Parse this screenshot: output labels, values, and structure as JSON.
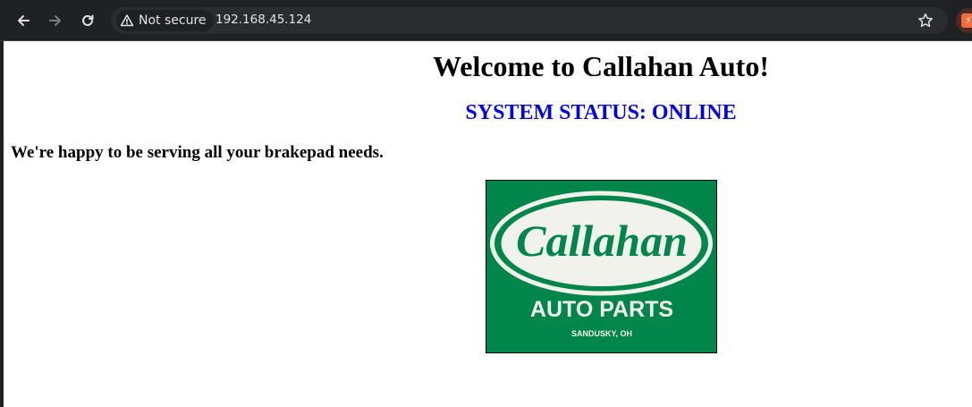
{
  "browser": {
    "security_label": "Not secure",
    "url": "192.168.45.124"
  },
  "page": {
    "heading": "Welcome to Callahan Auto!",
    "status": "SYSTEM STATUS: ONLINE",
    "tagline": "We're happy to be serving all your brakepad needs."
  },
  "logo": {
    "brand": "Callahan",
    "line": "AUTO PARTS",
    "location": "SANDUSKY, OH",
    "background_color": "#00854a"
  },
  "colors": {
    "status": "#0000ee",
    "toolbar": "#202124"
  }
}
